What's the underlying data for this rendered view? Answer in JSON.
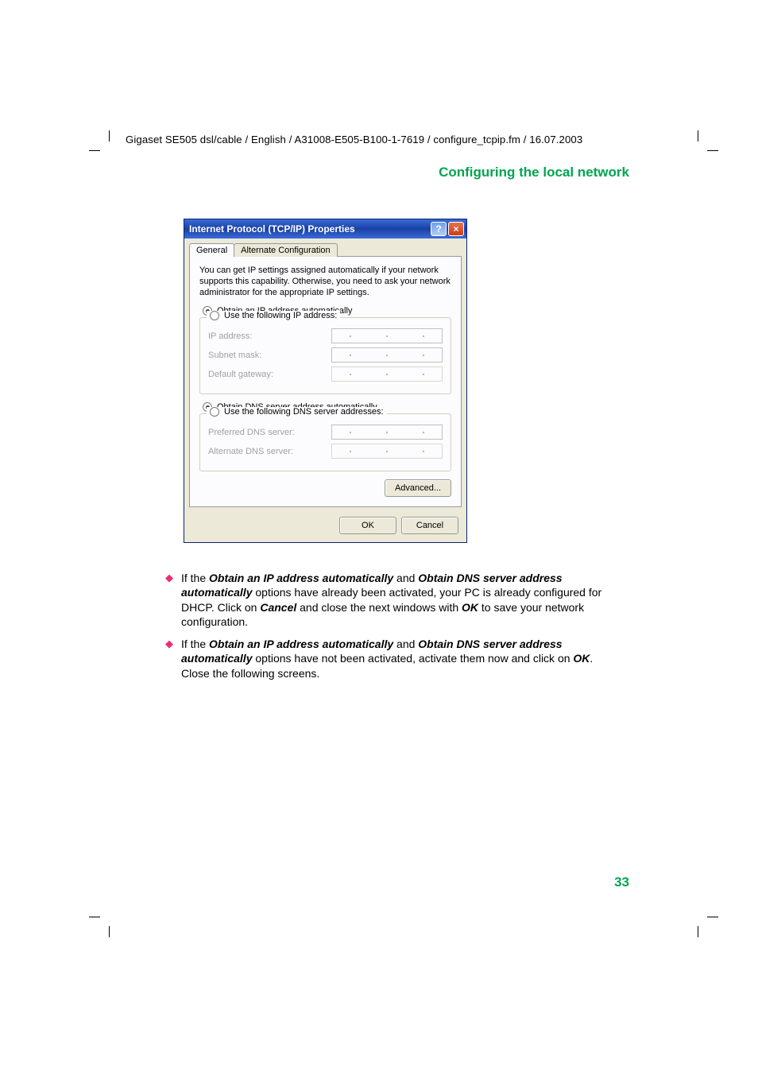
{
  "header": "Gigaset SE505 dsl/cable / English / A31008-E505-B100-1-7619 / configure_tcpip.fm / 16.07.2003",
  "section_title": "Configuring the local network",
  "page_number": "33",
  "dialog": {
    "title": "Internet Protocol (TCP/IP) Properties",
    "help": "?",
    "close": "×",
    "tabs": {
      "general": "General",
      "alternate": "Alternate Configuration"
    },
    "intro": "You can get IP settings assigned automatically if your network supports this capability. Otherwise, you need to ask your network administrator for the appropriate IP settings.",
    "ip": {
      "auto": "Obtain an IP address automatically",
      "manual": "Use the following IP address:",
      "ip_label": "IP address:",
      "subnet_label": "Subnet mask:",
      "gateway_label": "Default gateway:"
    },
    "dns": {
      "auto": "Obtain DNS server address automatically",
      "manual": "Use the following DNS server addresses:",
      "pref_label": "Preferred DNS server:",
      "alt_label": "Alternate DNS server:"
    },
    "advanced": "Advanced...",
    "ok": "OK",
    "cancel": "Cancel"
  },
  "bullets": [
    {
      "pre": "If the ",
      "b1": "Obtain an IP address automatically",
      "mid1": " and ",
      "b2": "Obtain DNS server address automatically",
      "rest1": " options have already been activated, your PC is already configured for DHCP. Click on ",
      "b3": "Cancel",
      "rest2": " and close the next windows with ",
      "b4": "OK",
      "rest3": " to save your network configuration."
    },
    {
      "pre": "If the ",
      "b1": "Obtain an IP address automatically",
      "mid1": " and ",
      "b2": "Obtain DNS server address automatically",
      "rest1": " options have not been activated, activate them now and click on ",
      "b3": "OK",
      "rest2": ". Close the following screens.",
      "b4": "",
      "rest3": ""
    }
  ]
}
